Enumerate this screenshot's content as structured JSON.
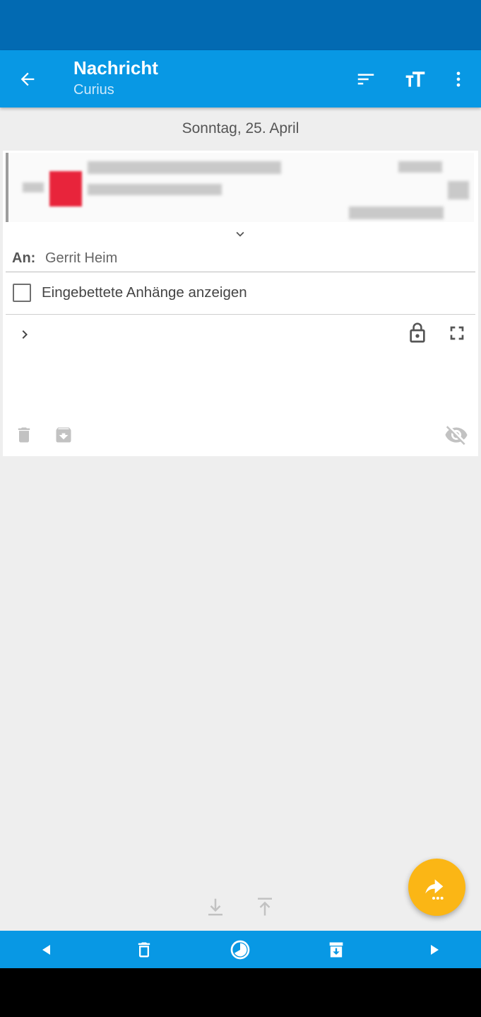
{
  "appbar": {
    "title": "Nachricht",
    "subtitle": "Curius",
    "icons": [
      "arrow-back-icon",
      "sort-icon",
      "text-size-icon",
      "more-vert-icon"
    ]
  },
  "message": {
    "date": "Sonntag, 25. April",
    "to_label": "An:",
    "to_value": "Gerrit Heim",
    "show_attachments_label": "Eingebettete Anhänge anzeigen"
  },
  "colors": {
    "statusbar": "#026ab2",
    "appbar": "#0898e4",
    "fab": "#fbb615",
    "background": "#eeeeee"
  }
}
